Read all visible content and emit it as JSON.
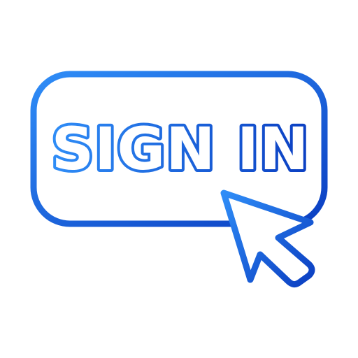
{
  "button": {
    "label": "SIGN IN"
  },
  "icons": {
    "cursor": "mouse-pointer-icon"
  },
  "colors": {
    "gradient_start": "#2f8df7",
    "gradient_end": "#0b3fc2",
    "label_fill": "#ffffff",
    "background": "#ffffff"
  }
}
